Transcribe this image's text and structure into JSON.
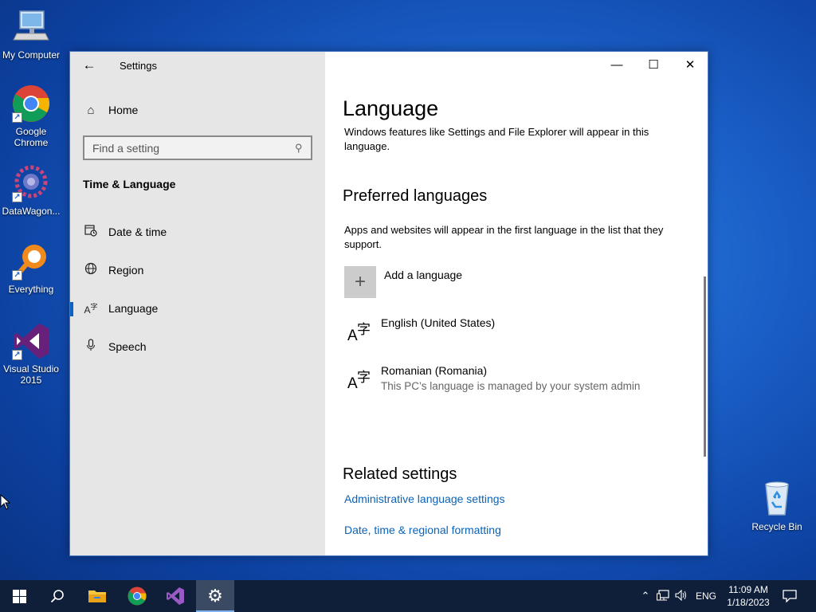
{
  "desktop": {
    "icons": [
      {
        "label": "My Computer"
      },
      {
        "label": "Google Chrome"
      },
      {
        "label": "DataWagon..."
      },
      {
        "label": "Everything"
      },
      {
        "label": "Visual Studio 2015"
      },
      {
        "label": "Recycle Bin"
      }
    ]
  },
  "window": {
    "app_title": "Settings",
    "back_glyph": "←",
    "controls": {
      "minimize": "—",
      "maximize": "☐",
      "close": "✕"
    }
  },
  "nav": {
    "home_label": "Home",
    "search_placeholder": "Find a setting",
    "section_heading": "Time & Language",
    "items": [
      {
        "label": "Date & time",
        "icon": "calendar-clock-icon"
      },
      {
        "label": "Region",
        "icon": "globe-icon"
      },
      {
        "label": "Language",
        "icon": "language-icon",
        "active": true
      },
      {
        "label": "Speech",
        "icon": "microphone-icon"
      }
    ],
    "accent_color": "#0a64c2"
  },
  "content": {
    "title": "Language",
    "windows_display_desc": "Windows features like Settings and File Explorer will appear in this language.",
    "preferred_heading": "Preferred languages",
    "preferred_desc": "Apps and websites will appear in the first language in the list that they support.",
    "add_language_label": "Add a language",
    "languages": [
      {
        "name": "English (United States)",
        "note": ""
      },
      {
        "name": "Romanian (Romania)",
        "note": "This PC’s language is managed by your system admin"
      }
    ],
    "related_heading": "Related settings",
    "related_links": [
      {
        "label": "Administrative language settings"
      },
      {
        "label": "Date, time & regional formatting"
      }
    ],
    "link_color": "#0a63b8"
  },
  "taskbar": {
    "input_language": "ENG",
    "time": "11:09 AM",
    "date": "1/18/2023"
  }
}
